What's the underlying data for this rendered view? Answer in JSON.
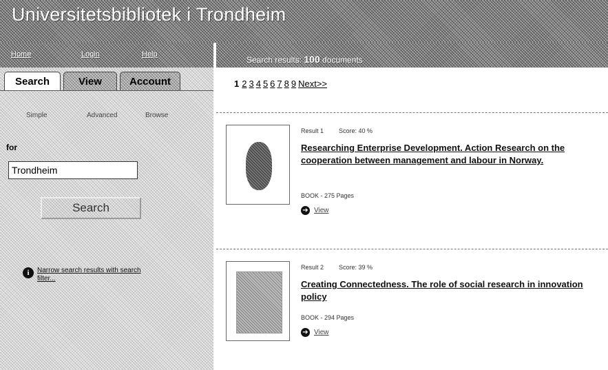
{
  "app": {
    "title": "Universitetsbibliotek i Trondheim"
  },
  "topnav": {
    "items": [
      "Home",
      "Login",
      "Help"
    ]
  },
  "results_bar": {
    "label": "Search results:",
    "count": "100",
    "unit": "documents"
  },
  "tabs": [
    "Search",
    "View",
    "Account"
  ],
  "subtabs": [
    "Simple",
    "Advanced",
    "Browse"
  ],
  "search": {
    "for_label": "for",
    "value": "Trondheim",
    "button_label": "Search"
  },
  "narrow": {
    "text": "Narrow search results with search filter..."
  },
  "pagination": {
    "current": "1",
    "pages": [
      "2",
      "3",
      "4",
      "5",
      "6",
      "7",
      "8",
      "9"
    ],
    "next": "Next>>"
  },
  "results": [
    {
      "number_label": "Result 1",
      "score_label": "Score: 40 %",
      "title": "Researching Enterprise Development. Action Research on the cooperation between management and labour in Norway.",
      "type": "BOOK - 275 Pages",
      "view_label": "View"
    },
    {
      "number_label": "Result 2",
      "score_label": "Score: 39 %",
      "title": "Creating Connectedness. The role of social research in innovation policy",
      "type": "BOOK - 294 Pages",
      "view_label": "View"
    }
  ]
}
